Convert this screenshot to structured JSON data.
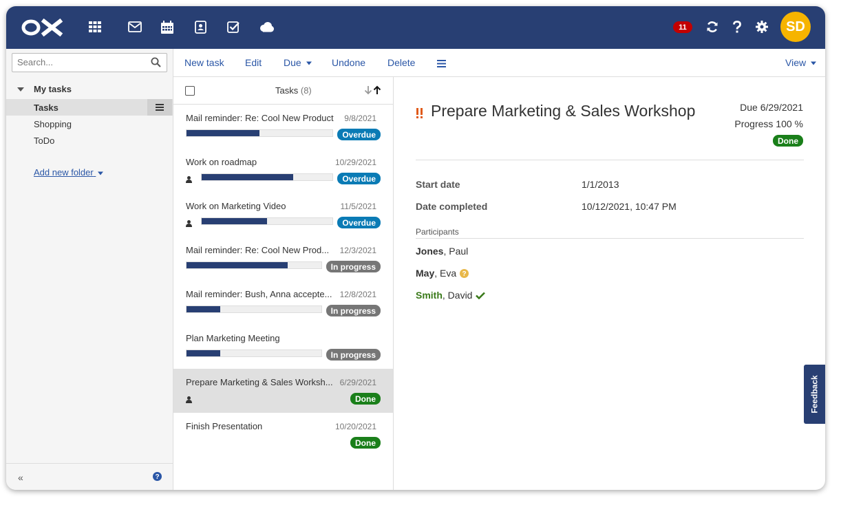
{
  "header": {
    "logo": "OX",
    "apps": [
      "apps-grid-icon",
      "mail-icon",
      "calendar-icon",
      "addressbook-icon",
      "tasks-icon",
      "drive-cloud-icon"
    ],
    "notification_count": "11",
    "avatar_initials": "SD",
    "brand_color": "#283f73",
    "avatar_color": "#f6b400"
  },
  "sidebar": {
    "search_placeholder": "Search...",
    "root_label": "My tasks",
    "folders": [
      {
        "label": "Tasks",
        "selected": true
      },
      {
        "label": "Shopping",
        "selected": false
      },
      {
        "label": "ToDo",
        "selected": false
      }
    ],
    "add_folder_label": "Add new folder"
  },
  "toolbar": {
    "new_task": "New task",
    "edit": "Edit",
    "due": "Due",
    "undone": "Undone",
    "delete": "Delete",
    "view": "View"
  },
  "list": {
    "title": "Tasks",
    "count": "(8)",
    "items": [
      {
        "title": "Mail reminder: Re: Cool New Product",
        "date": "9/8/2021",
        "progress": 0.5,
        "status": "Overdue",
        "status_color": "#0a7bb5",
        "has_participants": false
      },
      {
        "title": "Work on roadmap",
        "date": "10/29/2021",
        "progress": 0.7,
        "status": "Overdue",
        "status_color": "#0a7bb5",
        "has_participants": true
      },
      {
        "title": "Work on Marketing Video",
        "date": "11/5/2021",
        "progress": 0.5,
        "status": "Overdue",
        "status_color": "#0a7bb5",
        "has_participants": true
      },
      {
        "title": "Mail reminder: Re: Cool New Prod...",
        "date": "12/3/2021",
        "progress": 0.75,
        "status": "In progress",
        "status_color": "#767676",
        "has_participants": false
      },
      {
        "title": "Mail reminder: Bush, Anna accepte...",
        "date": "12/8/2021",
        "progress": 0.25,
        "status": "In progress",
        "status_color": "#767676",
        "has_participants": false
      },
      {
        "title": "Plan Marketing Meeting",
        "date": "",
        "progress": 0.25,
        "status": "In progress",
        "status_color": "#767676",
        "has_participants": false
      },
      {
        "title": "Prepare Marketing & Sales Worksh...",
        "date": "6/29/2021",
        "progress": null,
        "status": "Done",
        "status_color": "#1a7f1a",
        "has_participants": true,
        "selected": true
      },
      {
        "title": "Finish Presentation",
        "date": "10/20/2021",
        "progress": null,
        "status": "Done",
        "status_color": "#1a7f1a",
        "has_participants": false
      }
    ]
  },
  "detail": {
    "title": "Prepare Marketing & Sales Workshop",
    "due": "Due 6/29/2021",
    "progress": "Progress 100 %",
    "status": "Done",
    "start_label": "Start date",
    "start_value": "1/1/2013",
    "completed_label": "Date completed",
    "completed_value": "10/12/2021, 10:47 PM",
    "participants_label": "Participants",
    "participants": [
      {
        "last": "Jones",
        "first": ", Paul",
        "state": "none"
      },
      {
        "last": "May",
        "first": ", Eva",
        "state": "tentative"
      },
      {
        "last": "Smith",
        "first": ", David",
        "state": "accepted"
      }
    ]
  },
  "feedback_label": "Feedback"
}
